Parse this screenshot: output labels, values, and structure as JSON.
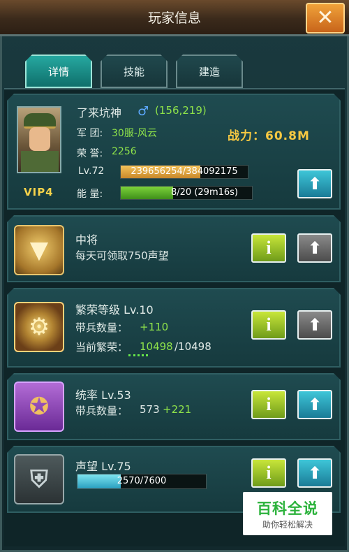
{
  "window": {
    "title": "玩家信息"
  },
  "tabs": [
    {
      "label": "详情",
      "active": true
    },
    {
      "label": "技能",
      "active": false
    },
    {
      "label": "建造",
      "active": false
    }
  ],
  "profile": {
    "name": "了来坑神",
    "gender_symbol": "♂",
    "coords": "(156,219)",
    "legion_label": "军 团:",
    "legion_value": "30服-风云",
    "honor_label": "荣 誉:",
    "honor_value": "2256",
    "power": "战力：60.8M",
    "level_label": "Lv.72",
    "xp_text": "239656254/384092175",
    "xp_fraction": 0.624,
    "energy_label": "能 量:",
    "energy_text": "8/20 (29m16s)",
    "energy_fraction": 0.4,
    "vip": "VIP4"
  },
  "rows": [
    {
      "title": "中将",
      "line1": "每天可领取750声望",
      "icon": "rank-badge-icon"
    },
    {
      "title": "繁荣等级 Lv.10",
      "line1_label": "带兵数量：",
      "line1_value": "+110",
      "line2_label": "当前繁荣：",
      "line2_value": "10498",
      "line2_max": "/10498",
      "icon": "gear-medal-icon"
    },
    {
      "title": "统率 Lv.53",
      "line1_label": "带兵数量：",
      "line1_base": "573",
      "line1_value": "+221",
      "icon": "book-icon"
    },
    {
      "title": "声望 Lv.75",
      "bar_text": "2570/7600",
      "bar_fraction": 0.338,
      "icon": "shield-icon"
    }
  ],
  "watermark": {
    "line1": "百科全说",
    "line2": "助你轻松解决"
  },
  "colors": {
    "accent_cyan": "#26a8a0",
    "power_gold": "#f6c842",
    "value_green": "#8ee24a"
  }
}
